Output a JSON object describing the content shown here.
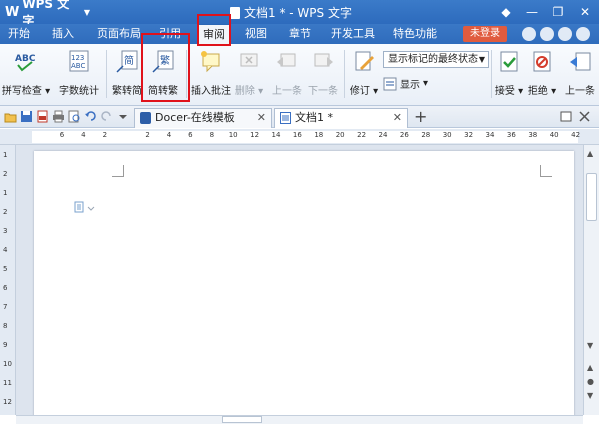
{
  "app": {
    "name": "WPS 文字",
    "logo": "W"
  },
  "window": {
    "title": "文档1 * - WPS 文字"
  },
  "menu": {
    "tabs": [
      "开始",
      "插入",
      "页面布局",
      "引用",
      "审阅",
      "视图",
      "章节",
      "开发工具",
      "特色功能"
    ],
    "active": "审阅",
    "login_label": "未登录"
  },
  "ribbon": {
    "spellcheck": "拼写检查",
    "wordcount": "字数统计",
    "trad_to_simp": "繁转简",
    "simp_to_trad": "简转繁",
    "insert_comment": "插入批注",
    "delete": "删除",
    "previous": "上一条",
    "next": "下一条",
    "track_changes": "修订",
    "show": "显示",
    "markup_mode": "显示标记的最终状态",
    "accept": "接受",
    "reject": "拒绝",
    "prev_change": "上一条",
    "icons": {
      "abc": "ABC",
      "num": "123",
      "jian": "简",
      "fan": "繁"
    }
  },
  "doc_tabs": [
    {
      "label": "Docer-在线模板"
    },
    {
      "label": "文档1 *"
    }
  ],
  "ruler": {
    "h_ticks": [
      "6",
      "4",
      "2",
      "",
      "2",
      "4",
      "6",
      "8",
      "10",
      "12",
      "14",
      "16",
      "18",
      "20",
      "22",
      "24",
      "26",
      "28",
      "30",
      "32",
      "34",
      "36",
      "38",
      "40",
      "42"
    ],
    "v_ticks": [
      "1",
      "2",
      "1",
      "2",
      "3",
      "4",
      "5",
      "6",
      "7",
      "8",
      "9",
      "10",
      "11",
      "12"
    ]
  },
  "colors": {
    "accent": "#2f6cbc",
    "login": "#e05b3f",
    "highlight": "#e0121b"
  }
}
